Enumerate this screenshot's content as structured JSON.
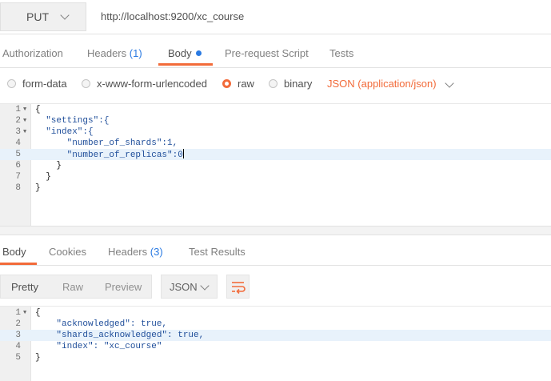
{
  "request": {
    "method": "PUT",
    "url": "http://localhost:9200/xc_course"
  },
  "request_tabs": [
    {
      "label": "Authorization"
    },
    {
      "label": "Headers",
      "count": "(1)"
    },
    {
      "label": "Body"
    },
    {
      "label": "Pre-request Script"
    },
    {
      "label": "Tests"
    }
  ],
  "body_modes": {
    "options": [
      "form-data",
      "x-www-form-urlencoded",
      "raw",
      "binary"
    ],
    "selected": "raw",
    "content_type": "JSON (application/json)"
  },
  "request_body": {
    "line_numbers": [
      "1",
      "2",
      "3",
      "4",
      "5",
      "6",
      "7",
      "8"
    ],
    "lines": [
      "{",
      "  \"settings\":{",
      "  \"index\":{",
      "      \"number_of_shards\":1,",
      "      \"number_of_replicas\":0",
      "    }",
      "  }",
      "}"
    ]
  },
  "response_tabs": [
    {
      "label": "Body"
    },
    {
      "label": "Cookies"
    },
    {
      "label": "Headers",
      "count": "(3)"
    },
    {
      "label": "Test Results"
    }
  ],
  "response_toolbar": {
    "views": [
      "Pretty",
      "Raw",
      "Preview"
    ],
    "selected_view": "Pretty",
    "format": "JSON"
  },
  "response_body": {
    "line_numbers": [
      "1",
      "2",
      "3",
      "4",
      "5"
    ],
    "lines": [
      "{",
      "    \"acknowledged\": true,",
      "    \"shards_acknowledged\": true,",
      "    \"index\": \"xc_course\"",
      "}"
    ]
  },
  "colors": {
    "accent": "#f26b3a",
    "link_blue": "#2a7ae2",
    "code_key": "#1f4e9a",
    "highlight_line": "#e8f2fb"
  },
  "icons": [
    "chevron-down-icon",
    "wrap-lines-icon",
    "fold-arrow-icon"
  ]
}
